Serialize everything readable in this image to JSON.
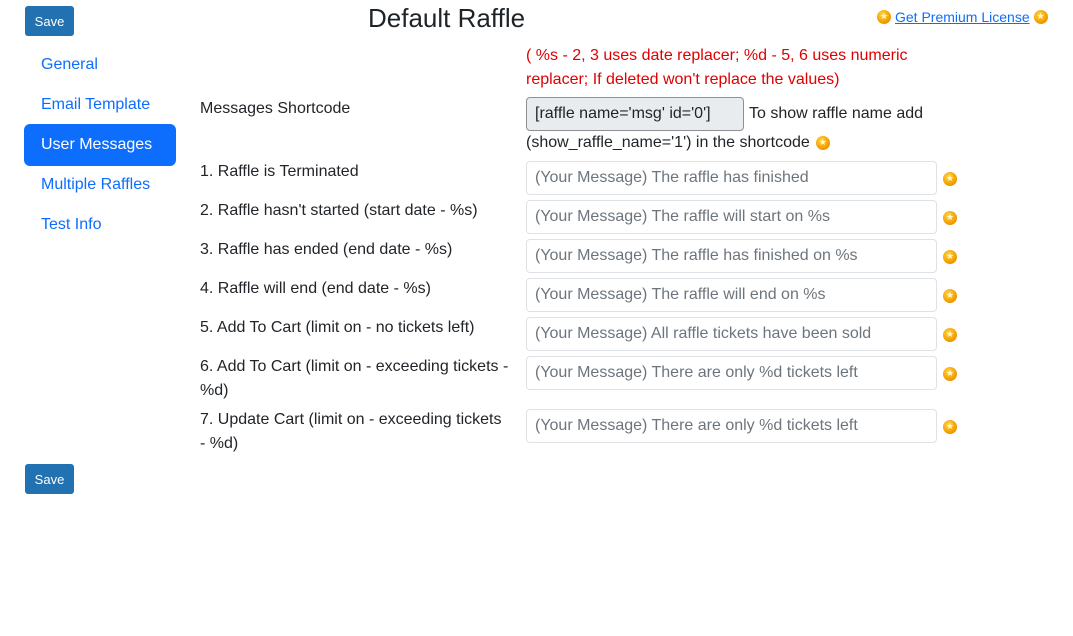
{
  "toolbar": {
    "save_label": "Save"
  },
  "page": {
    "title": "Default Raffle"
  },
  "premium": {
    "link_text": "Get Premium License ",
    "icon": "premium-star-icon"
  },
  "sidebar": {
    "items": [
      {
        "label": "General",
        "active": false
      },
      {
        "label": "Email Template",
        "active": false
      },
      {
        "label": "User Messages",
        "active": true
      },
      {
        "label": "Multiple Raffles",
        "active": false
      },
      {
        "label": "Test Info",
        "active": false
      }
    ]
  },
  "note": "( %s - 2, 3 uses date replacer; %d - 5, 6 uses numeric replacer; If deleted won't replace the values)",
  "shortcode": {
    "label": "Messages Shortcode",
    "value": "[raffle name='msg' id='0']",
    "hint_line1": "To show raffle name add",
    "hint_line2": "(show_raffle_name='1') in the shortcode"
  },
  "messages": [
    {
      "label": "1. Raffle is Terminated",
      "placeholder": "(Your Message) The raffle has finished"
    },
    {
      "label": "2. Raffle hasn't started (start date - %s)",
      "placeholder": "(Your Message) The raffle will start on %s"
    },
    {
      "label": "3. Raffle has ended (end date - %s)",
      "placeholder": "(Your Message) The raffle has finished on %s"
    },
    {
      "label": "4. Raffle will end (end date - %s)",
      "placeholder": "(Your Message) The raffle will end on %s"
    },
    {
      "label": "5. Add To Cart (limit on - no tickets left)",
      "placeholder": "(Your Message) All raffle tickets have been sold"
    },
    {
      "label": "6. Add To Cart (limit on - exceeding tickets - %d)",
      "placeholder": "(Your Message) There are only %d tickets left"
    },
    {
      "label": "7. Update Cart (limit on - exceeding tickets - %d)",
      "placeholder": "(Your Message) There are only %d tickets left"
    }
  ],
  "colors": {
    "save": "#2271b1",
    "accent": "#0d6efd",
    "note": "#e00000",
    "star": "#f5a300"
  }
}
